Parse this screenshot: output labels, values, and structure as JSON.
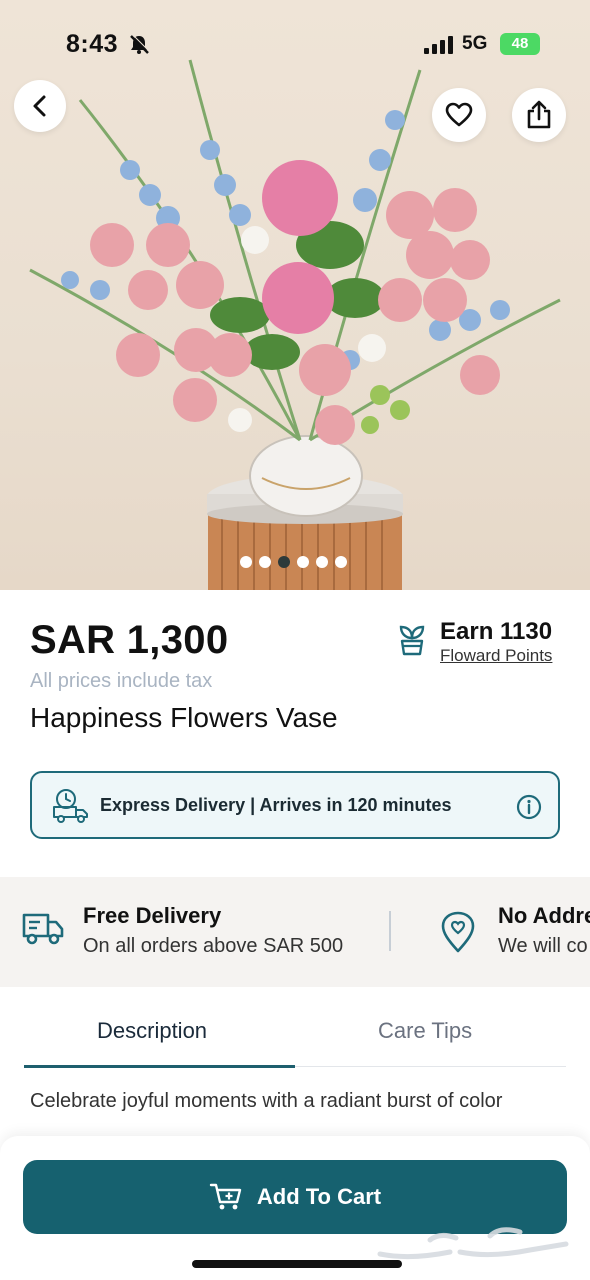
{
  "status_bar": {
    "time": "8:43",
    "network": "5G",
    "battery": "48"
  },
  "product": {
    "price": "SAR 1,300",
    "tax_note": "All prices include tax",
    "name": "Happiness Flowers Vase",
    "image_count": 6,
    "active_image_index": 2
  },
  "points": {
    "title": "Earn 1130",
    "link": "Floward Points"
  },
  "delivery_banner": {
    "text": "Express Delivery | Arrives in 120 minutes"
  },
  "promos": [
    {
      "title": "Free Delivery",
      "subtitle": "On all orders above SAR 500",
      "icon": "truck-icon"
    },
    {
      "title": "No Addre",
      "subtitle": "We will co",
      "icon": "location-pin-icon"
    }
  ],
  "tabs": {
    "description": "Description",
    "care_tips": "Care Tips",
    "active": "description"
  },
  "description_text": "Celebrate joyful moments with a radiant burst of color",
  "cart": {
    "label": "Add To Cart"
  },
  "colors": {
    "primary": "#16616f",
    "accent_border": "#1e6a7a",
    "tax_note": "#a9b4c2",
    "battery": "#4cd964"
  }
}
